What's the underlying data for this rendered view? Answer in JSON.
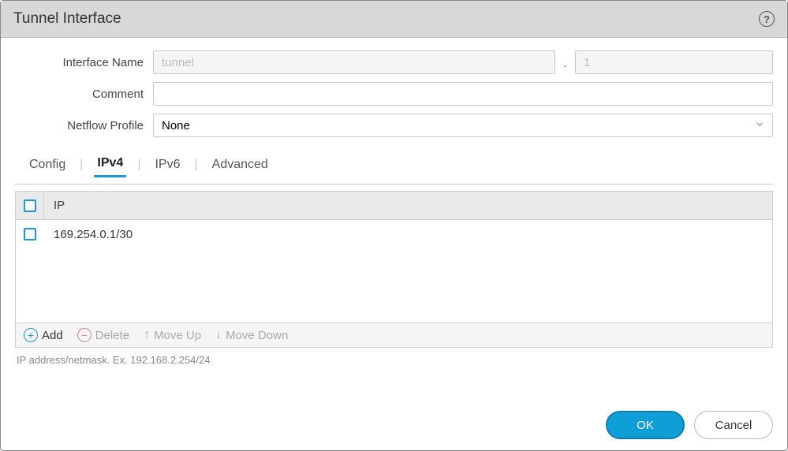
{
  "dialog": {
    "title": "Tunnel Interface"
  },
  "form": {
    "interface_name_label": "Interface Name",
    "interface_name_placeholder": "tunnel",
    "interface_name_value": "",
    "interface_unit_placeholder": "1",
    "interface_unit_value": "",
    "comment_label": "Comment",
    "comment_value": "",
    "netflow_label": "Netflow Profile",
    "netflow_value": "None"
  },
  "tabs": {
    "config": "Config",
    "ipv4": "IPv4",
    "ipv6": "IPv6",
    "advanced": "Advanced"
  },
  "table": {
    "header_ip": "IP",
    "rows": [
      {
        "ip": "169.254.0.1/30"
      }
    ]
  },
  "toolbar": {
    "add": "Add",
    "delete": "Delete",
    "move_up": "Move Up",
    "move_down": "Move Down"
  },
  "hint": "IP address/netmask. Ex. 192.168.2.254/24",
  "buttons": {
    "ok": "OK",
    "cancel": "Cancel"
  }
}
